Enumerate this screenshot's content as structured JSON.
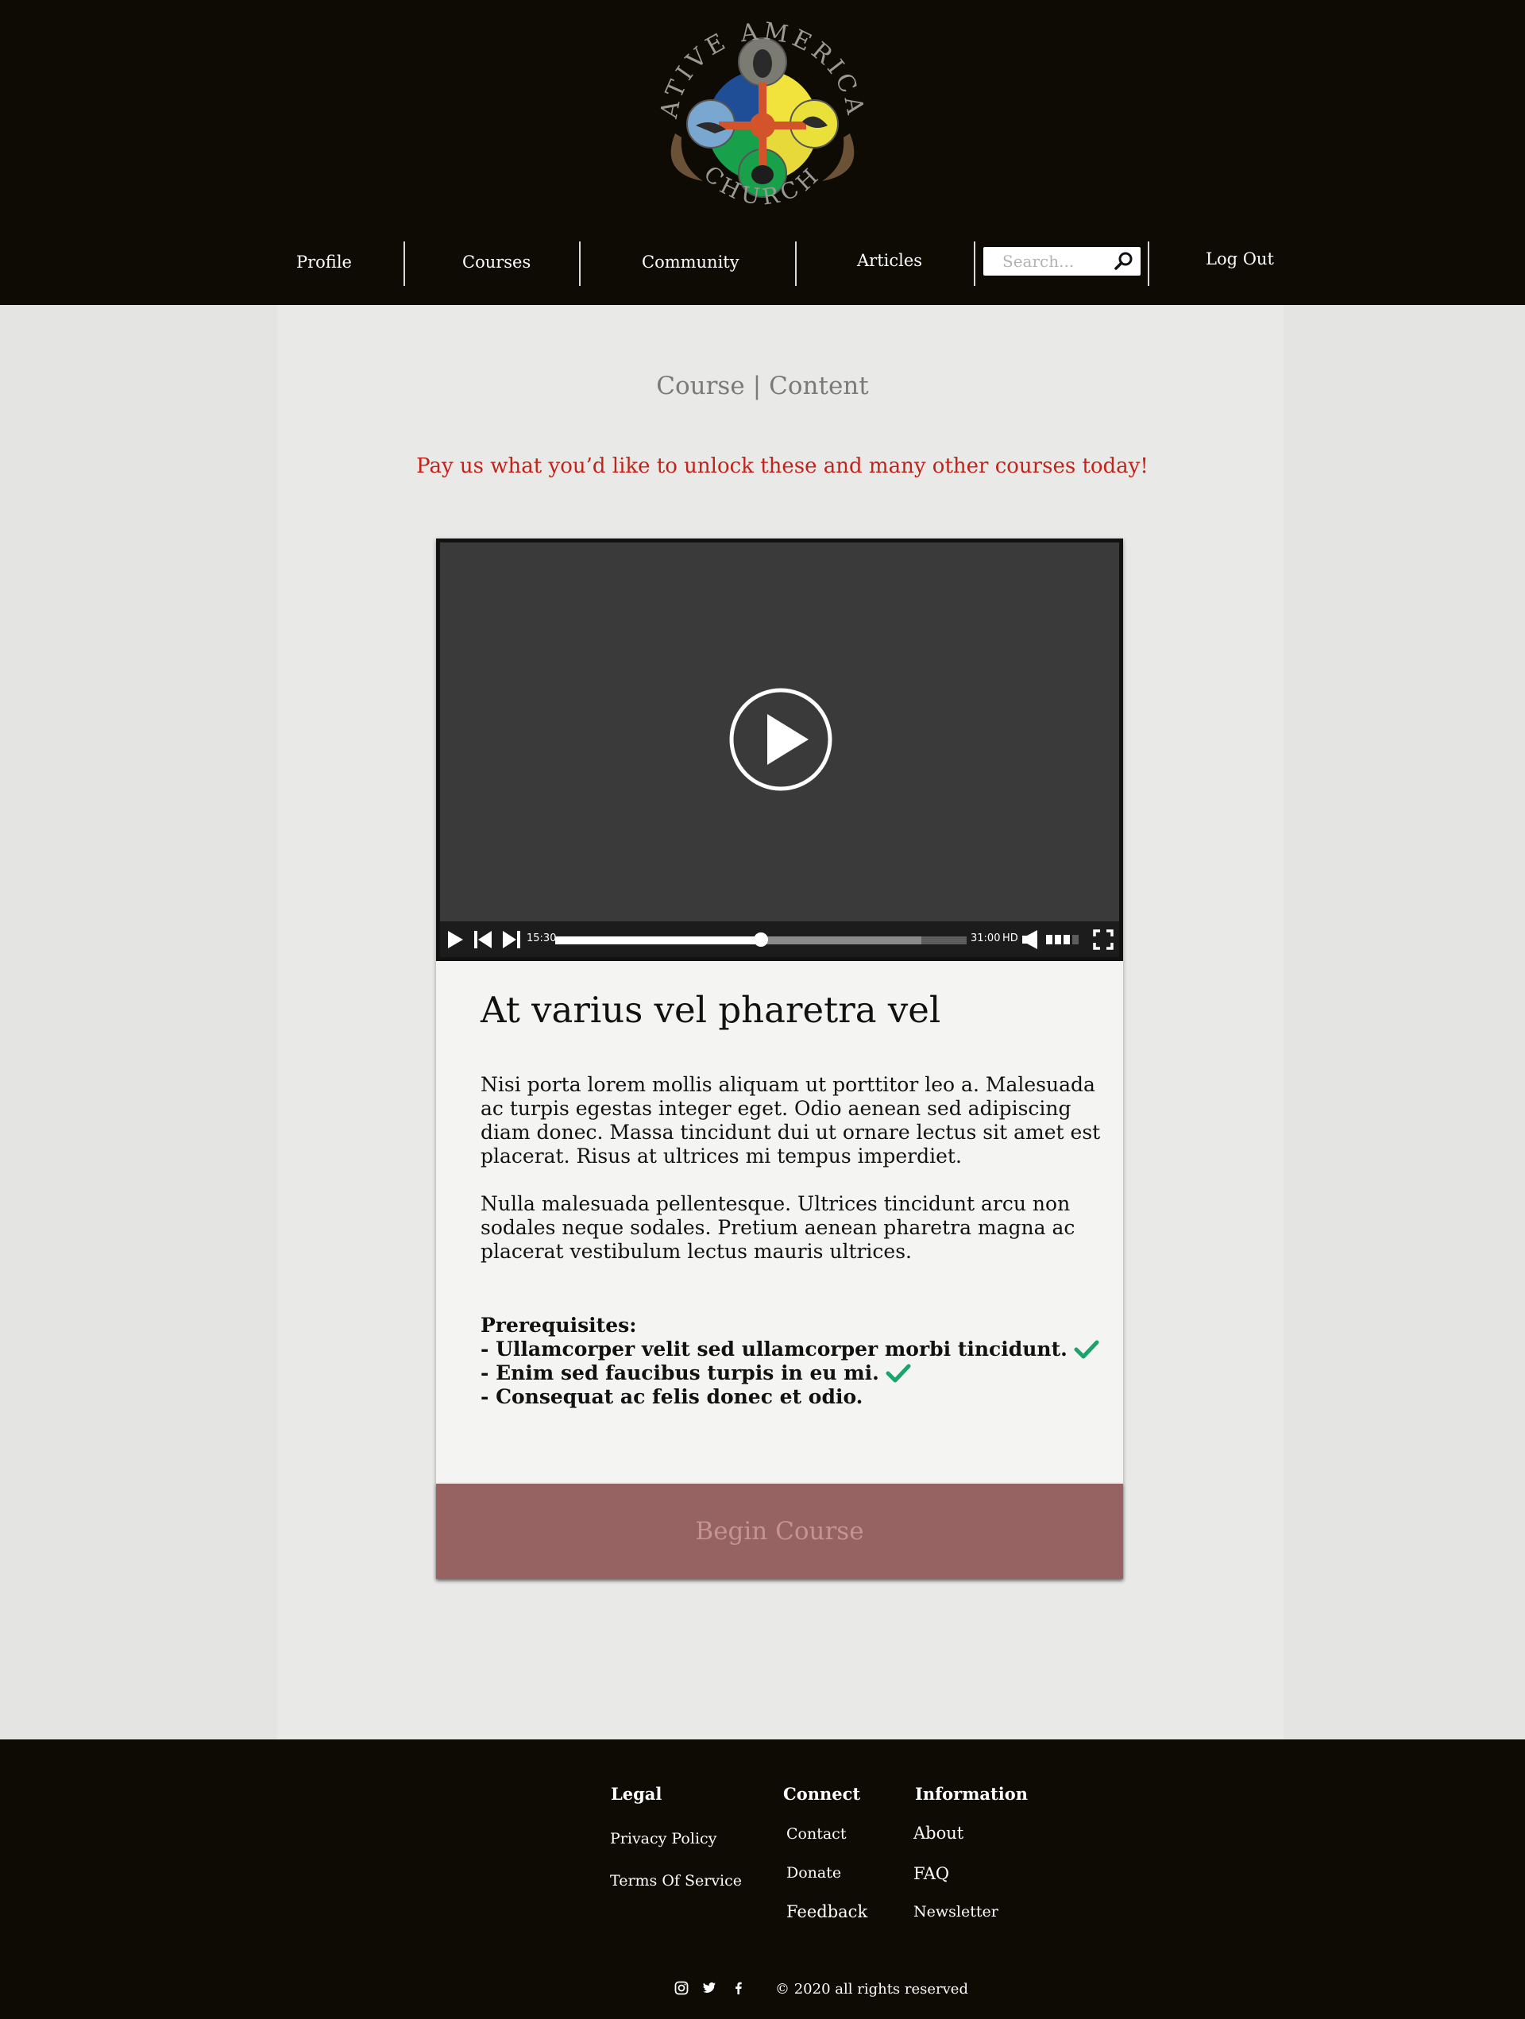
{
  "header": {
    "logo": {
      "top_text": "NATIVE AMERICAN",
      "bottom_text": "CHURCH"
    },
    "nav": {
      "profile": "Profile",
      "courses": "Courses",
      "community": "Community",
      "articles": "Articles",
      "logout": "Log Out"
    },
    "search": {
      "placeholder": "Search...",
      "icon": "search-icon"
    }
  },
  "breadcrumb": {
    "course": "Course",
    "separator": "|",
    "content": "Content"
  },
  "promo_text": "Pay us what you’d like to unlock these and many other courses today!",
  "video": {
    "current_time": "15:30",
    "duration": "31:00",
    "quality": "HD",
    "progress_fraction": 0.5,
    "buffered_fraction": 0.89,
    "volume_fraction": 0.75
  },
  "course": {
    "title": "At varius vel pharetra vel",
    "paragraph1": "Nisi porta lorem mollis aliquam ut porttitor leo a. Malesuada ac turpis egestas integer eget. Odio aenean sed adipiscing diam donec. Massa tincidunt dui ut ornare lectus sit amet est placerat. Risus at ultrices mi tempus imperdiet.",
    "paragraph2": "Nulla malesuada pellentesque. Ultrices tincidunt arcu non sodales neque sodales. Pretium aenean pharetra magna ac placerat vestibulum lectus mauris ultrices.",
    "prerequisites_heading": "Prerequisites:",
    "prerequisites": [
      {
        "text": "- Ullamcorper velit sed ullamcorper morbi tincidunt.",
        "completed": true
      },
      {
        "text": "- Enim sed faucibus turpis in eu mi.",
        "completed": true
      },
      {
        "text": "- Consequat ac felis donec et odio.",
        "completed": false
      }
    ],
    "begin_button": "Begin Course"
  },
  "colors": {
    "header_bg": "#0e0b04",
    "promo_red": "#c0231a",
    "check_green": "#1aa36b",
    "button_bg": "#976262",
    "button_text": "#c49494"
  },
  "footer": {
    "legal": {
      "heading": "Legal",
      "privacy": "Privacy Policy",
      "terms": "Terms Of Service"
    },
    "connect": {
      "heading": "Connect",
      "contact": "Contact",
      "donate": "Donate",
      "feedback": "Feedback"
    },
    "information": {
      "heading": "Information",
      "about": "About",
      "faq": "FAQ",
      "newsletter": "Newsletter"
    },
    "social": [
      "instagram-icon",
      "twitter-icon",
      "facebook-icon"
    ],
    "copyright": "© 2020 all rights reserved"
  }
}
